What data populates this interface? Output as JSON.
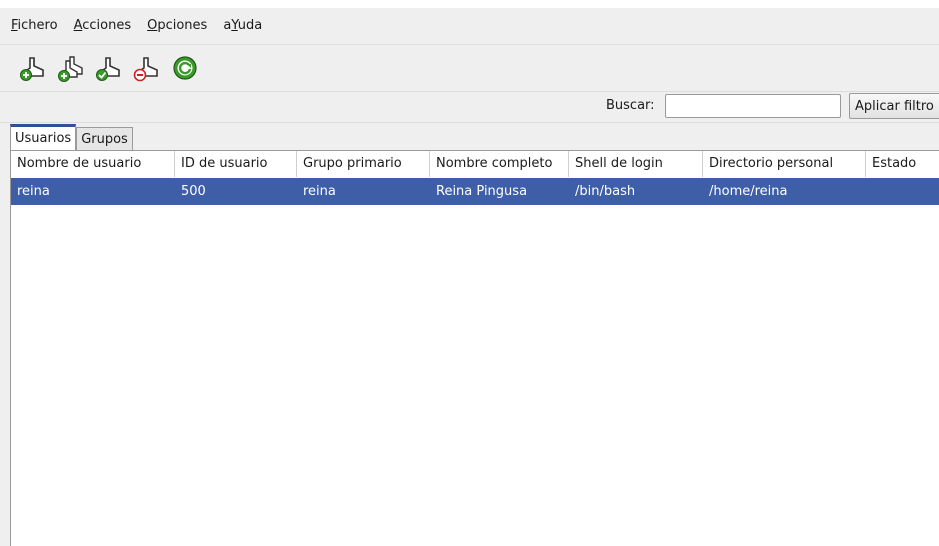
{
  "menu": {
    "items": [
      {
        "pre": "",
        "ul": "F",
        "post": "ichero"
      },
      {
        "pre": "",
        "ul": "A",
        "post": "cciones"
      },
      {
        "pre": "",
        "ul": "O",
        "post": "pciones"
      },
      {
        "pre": "a",
        "ul": "Y",
        "post": "uda"
      }
    ]
  },
  "toolbar": {
    "icons": [
      "add-user-icon",
      "add-group-icon",
      "edit-user-icon",
      "delete-user-icon",
      "refresh-icon"
    ],
    "colors": {
      "green": "#3a9a2a",
      "red": "#cc2222",
      "figure": "#333333"
    }
  },
  "search": {
    "label": "Buscar:",
    "value": "",
    "placeholder": "",
    "filter_button": "Aplicar filtro"
  },
  "tabs": [
    {
      "label": "Usuarios",
      "active": true
    },
    {
      "label": "Grupos",
      "active": false
    }
  ],
  "table": {
    "columns": [
      "Nombre de usuario",
      "ID de usuario",
      "Grupo primario",
      "Nombre completo",
      "Shell de login",
      "Directorio personal",
      "Estado"
    ],
    "rows": [
      [
        "reina",
        "500",
        "reina",
        "Reina Pingusa",
        "/bin/bash",
        "/home/reina",
        ""
      ]
    ],
    "selected_row_color": "#3e5ea7"
  }
}
